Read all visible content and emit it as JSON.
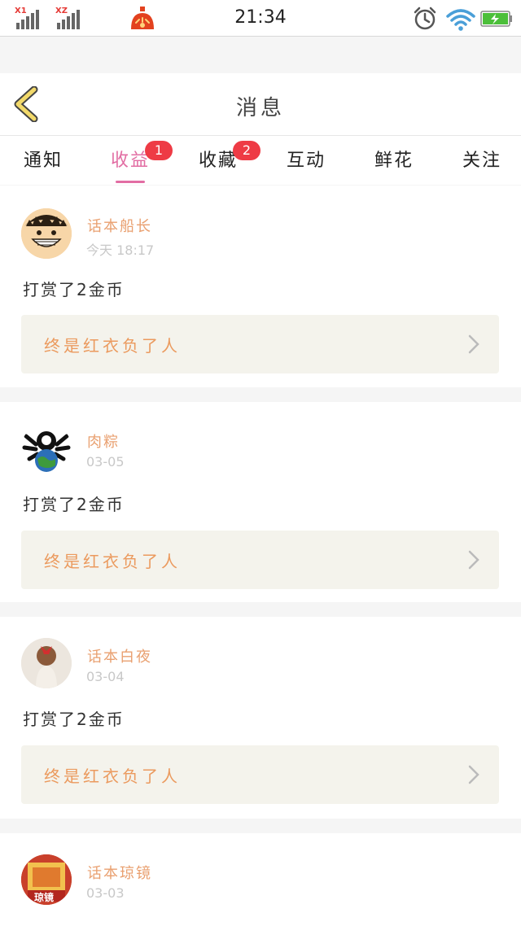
{
  "status_bar": {
    "sim1_label": "X1",
    "sim2_label": "XZ",
    "time": "21:34"
  },
  "header": {
    "title": "消息"
  },
  "tabs": [
    {
      "label": "通知",
      "badge": ""
    },
    {
      "label": "收益",
      "badge": "1",
      "active": true
    },
    {
      "label": "收藏",
      "badge": "2"
    },
    {
      "label": "互动",
      "badge": ""
    },
    {
      "label": "鲜花",
      "badge": ""
    },
    {
      "label": "关注",
      "badge": ""
    }
  ],
  "messages": [
    {
      "user": "话本船长",
      "time": "今天 18:17",
      "text": "打赏了2金币",
      "work_title": "终是红衣负了人"
    },
    {
      "user": "肉粽",
      "time": "03-05",
      "text": "打赏了2金币",
      "work_title": "终是红衣负了人"
    },
    {
      "user": "话本白夜",
      "time": "03-04",
      "text": "打赏了2金币",
      "work_title": "终是红衣负了人"
    },
    {
      "user": "话本琼镜",
      "time": "03-03",
      "text": "",
      "work_title": ""
    }
  ],
  "avatar4_label": "琼镜",
  "colors": {
    "accent": "#e26da3",
    "badge": "#ee3b45",
    "username": "#e9a070",
    "work_title": "#eb9a5e",
    "work_box_bg": "#f4f3ec"
  }
}
